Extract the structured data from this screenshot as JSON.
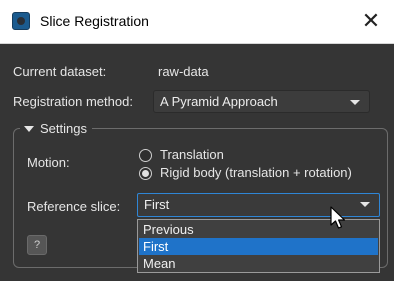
{
  "window": {
    "title": "Slice Registration",
    "close_glyph": "✕"
  },
  "dataset": {
    "label": "Current dataset:",
    "value": "raw-data"
  },
  "registration": {
    "label": "Registration method:",
    "selected": "A Pyramid Approach"
  },
  "settings": {
    "title": "Settings",
    "motion_label": "Motion:",
    "motion_options": [
      {
        "label": "Translation",
        "checked": false
      },
      {
        "label": "Rigid body (translation + rotation)",
        "checked": true
      }
    ],
    "reference_label": "Reference slice:",
    "reference_selected": "First",
    "reference_options": [
      {
        "label": "Previous",
        "selected": false
      },
      {
        "label": "First",
        "selected": true
      },
      {
        "label": "Mean",
        "selected": false
      }
    ],
    "help_label": "?"
  },
  "icons": {
    "app": "slice-registration-app-icon",
    "close": "close-icon",
    "combo_arrow": "chevron-down-icon",
    "group_collapse": "triangle-down-icon",
    "cursor": "mouse-pointer-icon"
  },
  "colors": {
    "dialog_bg": "#353535",
    "titlebar_bg": "#ffffff",
    "focus_border": "#2f86d6",
    "selection": "#1f73c9"
  }
}
